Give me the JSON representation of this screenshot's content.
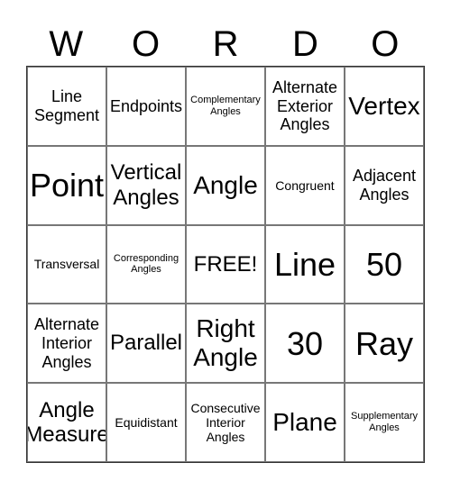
{
  "card": {
    "header": [
      "W",
      "O",
      "R",
      "D",
      "O"
    ],
    "cells": [
      {
        "text": "Line Segment",
        "size": "md"
      },
      {
        "text": "Endpoints",
        "size": "md"
      },
      {
        "text": "Complementary Angles",
        "size": "xs"
      },
      {
        "text": "Alternate Exterior Angles",
        "size": "md"
      },
      {
        "text": "Vertex",
        "size": "xl"
      },
      {
        "text": "Point",
        "size": "xxl"
      },
      {
        "text": "Vertical Angles",
        "size": "lg"
      },
      {
        "text": "Angle",
        "size": "xl"
      },
      {
        "text": "Congruent",
        "size": "sm"
      },
      {
        "text": "Adjacent Angles",
        "size": "md"
      },
      {
        "text": "Transversal",
        "size": "sm"
      },
      {
        "text": "Corresponding Angles",
        "size": "xs"
      },
      {
        "text": "FREE!",
        "size": "lg"
      },
      {
        "text": "Line",
        "size": "xxl"
      },
      {
        "text": "50",
        "size": "xxl"
      },
      {
        "text": "Alternate Interior Angles",
        "size": "md"
      },
      {
        "text": "Parallel",
        "size": "lg"
      },
      {
        "text": "Right Angle",
        "size": "xl"
      },
      {
        "text": "30",
        "size": "xxl"
      },
      {
        "text": "Ray",
        "size": "xxl"
      },
      {
        "text": "Angle Measure",
        "size": "lg"
      },
      {
        "text": "Equidistant",
        "size": "sm"
      },
      {
        "text": "Consecutive Interior Angles",
        "size": "sm"
      },
      {
        "text": "Plane",
        "size": "xl"
      },
      {
        "text": "Supplementary Angles",
        "size": "xs"
      }
    ]
  }
}
